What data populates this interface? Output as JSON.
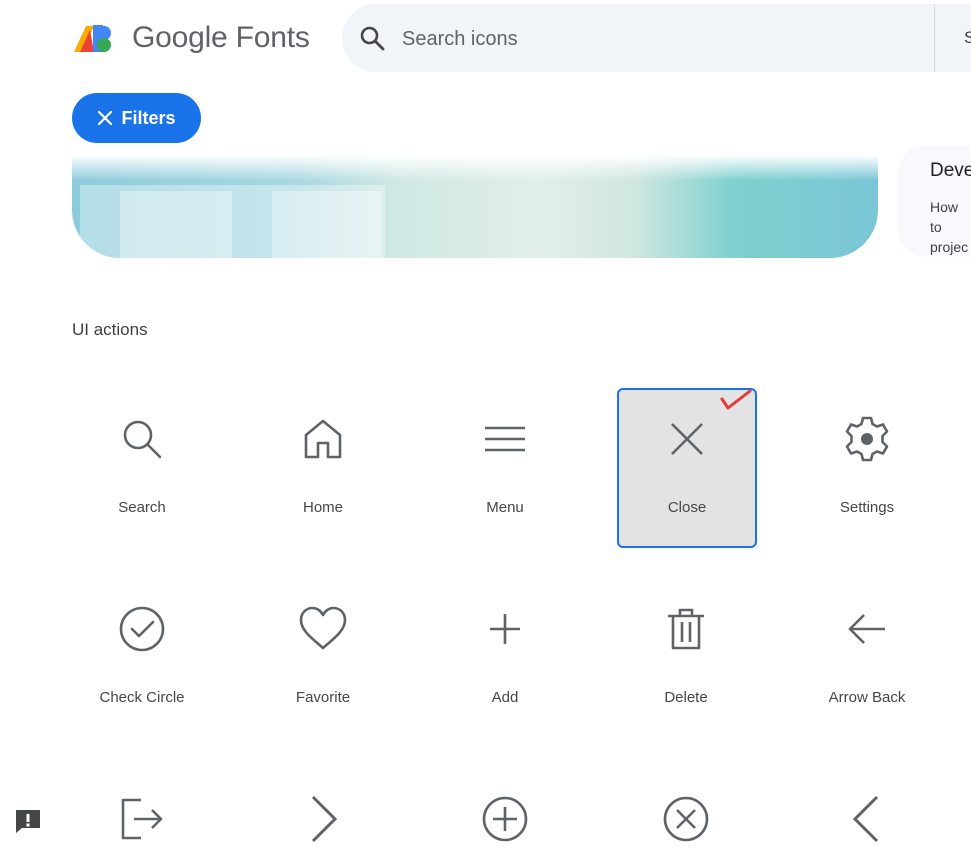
{
  "header": {
    "brand": "Google Fonts",
    "search": {
      "placeholder": "Search icons",
      "suffix": "S"
    }
  },
  "filters": {
    "label": "Filters"
  },
  "promo_card": {
    "title": "Deve",
    "description": "How to projec"
  },
  "section": {
    "title": "UI actions"
  },
  "icons": [
    {
      "label": "Search",
      "icon": "search-icon"
    },
    {
      "label": "Home",
      "icon": "home-icon"
    },
    {
      "label": "Menu",
      "icon": "menu-icon"
    },
    {
      "label": "Close",
      "icon": "close-icon",
      "selected": true
    },
    {
      "label": "Settings",
      "icon": "settings-icon"
    },
    {
      "label": "Check Circle",
      "icon": "check-circle-icon"
    },
    {
      "label": "Favorite",
      "icon": "favorite-icon"
    },
    {
      "label": "Add",
      "icon": "add-icon"
    },
    {
      "label": "Delete",
      "icon": "delete-icon"
    },
    {
      "label": "Arrow Back",
      "icon": "arrow-back-icon"
    },
    {
      "label": "",
      "icon": "logout-icon"
    },
    {
      "label": "",
      "icon": "chevron-right-icon"
    },
    {
      "label": "",
      "icon": "add-circle-icon"
    },
    {
      "label": "",
      "icon": "cancel-icon"
    },
    {
      "label": "",
      "icon": "chevron-left-icon"
    }
  ],
  "colors": {
    "accent": "#1a73e8",
    "selected_bg": "#e3e3e3",
    "annotation": "#e53935"
  }
}
